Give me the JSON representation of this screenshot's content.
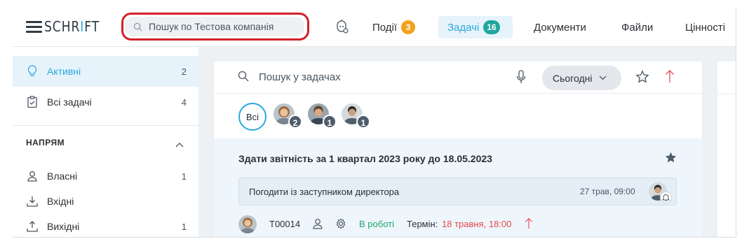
{
  "header": {
    "logo": {
      "pre": "SCHR",
      "accent": "I",
      "post": "FT"
    },
    "search_placeholder": "Пошук по Тестова компанія",
    "nav": [
      {
        "label": "Події",
        "badge": "3",
        "badge_color": "#f3a21b"
      },
      {
        "label": "Задачі",
        "badge": "16",
        "badge_color": "#20a6a0",
        "active": true
      },
      {
        "label": "Документи"
      },
      {
        "label": "Файли"
      },
      {
        "label": "Цінності"
      }
    ]
  },
  "sidebar": {
    "items": [
      {
        "label": "Активні",
        "count": "2",
        "icon": "lightbulb-icon",
        "active": true
      },
      {
        "label": "Всі задачі",
        "count": "4",
        "icon": "clipboard-check-icon"
      }
    ],
    "section_title": "НАПРЯМ",
    "direction_items": [
      {
        "label": "Власні",
        "count": "1",
        "icon": "person-icon"
      },
      {
        "label": "Вхідні",
        "count": "",
        "icon": "download-icon"
      },
      {
        "label": "Вихідні",
        "count": "1",
        "icon": "upload-icon"
      }
    ]
  },
  "tasks_panel": {
    "search_placeholder": "Пошук у задачах",
    "filter_label": "Сьогодні",
    "people": {
      "all_label": "Всі",
      "avatars": [
        {
          "count": "2"
        },
        {
          "count": "1"
        },
        {
          "count": "1"
        }
      ]
    },
    "task": {
      "title": "Здати звітність за 1 квартал 2023 року до 18.05.2023",
      "subtask": {
        "label": "Погодити із заступником директора",
        "date": "27 трав, 09:00"
      },
      "code": "T00014",
      "status": "В роботі",
      "deadline_label": "Термін:",
      "deadline_value": "18 травня, 18:00"
    }
  },
  "colors": {
    "accent": "#2aa8e0",
    "highlight_border": "#d32027",
    "status_green": "#20a66a",
    "deadline_red": "#e5484d"
  }
}
